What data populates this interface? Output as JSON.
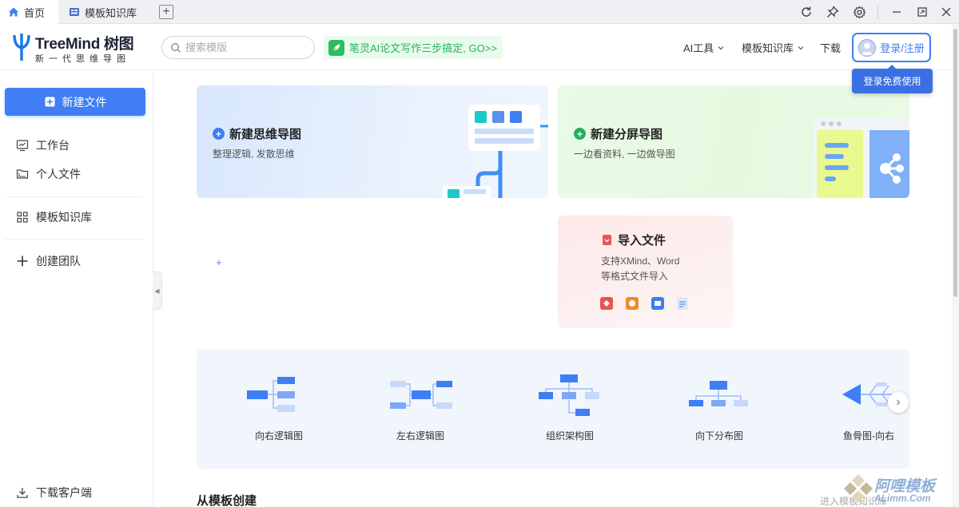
{
  "tabs": [
    {
      "label": "首页",
      "icon": "home-icon"
    },
    {
      "label": "模板知识库",
      "icon": "template-icon"
    }
  ],
  "window_controls": [
    "refresh-icon",
    "pin-icon",
    "gear-icon",
    "minimize-icon",
    "maximize-icon",
    "close-icon"
  ],
  "brand": {
    "name": "TreeMind 树图",
    "tagline": "新一代思维导图"
  },
  "search": {
    "placeholder": "搜索模版"
  },
  "promo": {
    "text": "笔灵AI论文写作三步搞定, GO>>"
  },
  "nav": {
    "ai_tools": "AI工具",
    "template_lib": "模板知识库",
    "download": "下载",
    "login": "登录/注册"
  },
  "tooltip": "登录免费使用",
  "sidebar": {
    "new_file": "新建文件",
    "items": [
      {
        "label": "工作台",
        "icon": "workspace-icon"
      },
      {
        "label": "个人文件",
        "icon": "folder-icon"
      },
      {
        "label": "模板知识库",
        "icon": "grid-icon"
      },
      {
        "label": "创建团队",
        "icon": "plus-icon"
      }
    ],
    "download_client": "下载客户端"
  },
  "cards": {
    "mindmap": {
      "title": "新建思维导图",
      "subtitle": "整理逻辑, 发散思维"
    },
    "split": {
      "title": "新建分屏导图",
      "subtitle": "一边看资料, 一边做导图"
    },
    "import": {
      "title": "导入文件",
      "desc_line1": "支持XMind、Word",
      "desc_line2": "等格式文件导入"
    }
  },
  "templates": [
    {
      "label": "向右逻辑图"
    },
    {
      "label": "左右逻辑图"
    },
    {
      "label": "组织架构图"
    },
    {
      "label": "向下分布图"
    },
    {
      "label": "鱼骨图-向右"
    }
  ],
  "section": {
    "from_template": "从模板创建",
    "enter_lib": "进入模板知识库"
  },
  "watermark": {
    "text": "阿哩模板",
    "url": "ALimm.Com"
  },
  "colors": {
    "primary": "#3f7ef5",
    "green": "#25b35b",
    "import_red": "#e8545a"
  }
}
